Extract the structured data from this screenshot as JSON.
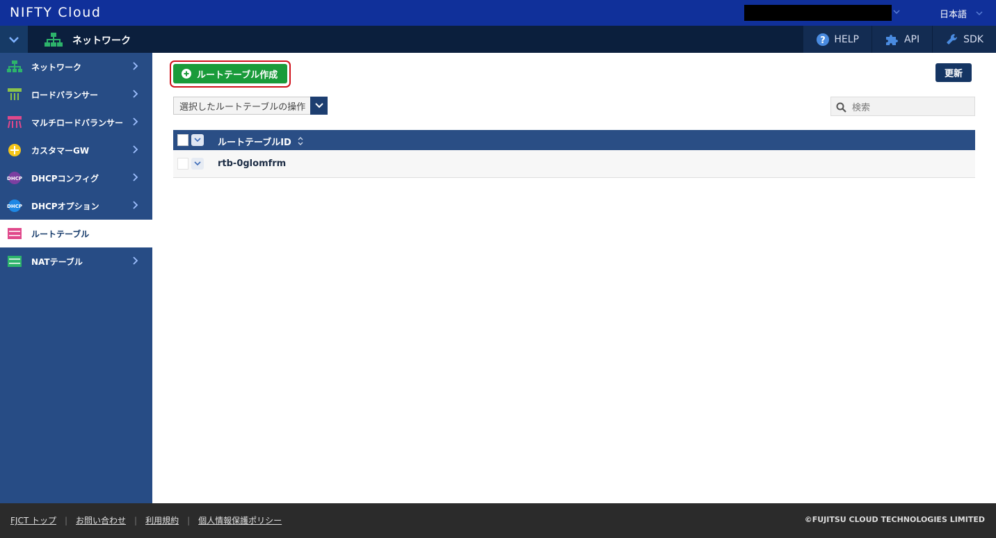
{
  "header": {
    "brand": "NIFTY Cloud",
    "language": "日本語"
  },
  "subbar": {
    "title": "ネットワーク",
    "links": [
      {
        "label": "HELP",
        "icon": "help-icon"
      },
      {
        "label": "API",
        "icon": "puzzle-icon"
      },
      {
        "label": "SDK",
        "icon": "wrench-icon"
      }
    ]
  },
  "sidebar": {
    "items": [
      {
        "label": "ネットワーク",
        "icon": "network-icon",
        "color": "#2db36b",
        "active": false,
        "chevron": true
      },
      {
        "label": "ロードバランサー",
        "icon": "load-balancer-icon",
        "color": "#8bc34a",
        "active": false,
        "chevron": true
      },
      {
        "label": "マルチロードバランサー",
        "icon": "multi-load-balancer-icon",
        "color": "#e0488b",
        "active": false,
        "chevron": true
      },
      {
        "label": "カスタマーGW",
        "icon": "customer-gateway-icon",
        "color": "#f5c518",
        "active": false,
        "chevron": true
      },
      {
        "label": "DHCPコンフィグ",
        "icon": "dhcp-config-icon",
        "color": "#7b3fa0",
        "active": false,
        "chevron": true
      },
      {
        "label": "DHCPオプション",
        "icon": "dhcp-option-icon",
        "color": "#1e88e5",
        "active": false,
        "chevron": true
      },
      {
        "label": "ルートテーブル",
        "icon": "route-table-icon",
        "color": "#e0488b",
        "active": true,
        "chevron": false
      },
      {
        "label": "NATテーブル",
        "icon": "nat-table-icon",
        "color": "#2db36b",
        "active": false,
        "chevron": true
      }
    ]
  },
  "main": {
    "create_label": "ルートテーブル作成",
    "refresh_label": "更新",
    "action_select": "選択したルートテーブルの操作",
    "search_placeholder": "検索",
    "table": {
      "header": "ルートテーブルID",
      "rows": [
        {
          "id": "rtb-0glomfrm"
        }
      ]
    }
  },
  "footer": {
    "links": [
      "FJCT トップ",
      "お問い合わせ",
      "利用規約",
      "個人情報保護ポリシー"
    ],
    "copyright": "©FUJITSU CLOUD TECHNOLOGIES LIMITED"
  }
}
